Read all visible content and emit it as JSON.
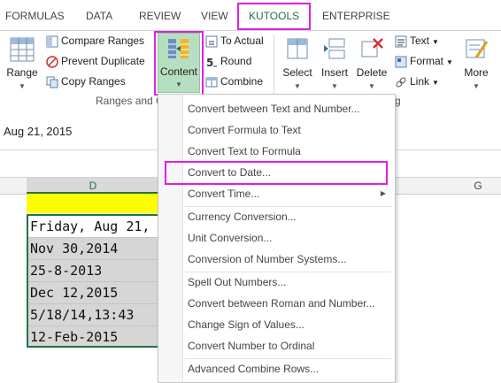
{
  "tabs": [
    {
      "label": "FORMULAS"
    },
    {
      "label": "DATA"
    },
    {
      "label": "REVIEW"
    },
    {
      "label": "VIEW"
    },
    {
      "label": "KUTOOLS"
    },
    {
      "label": "ENTERPRISE"
    }
  ],
  "ribbon": {
    "range_label": "Range",
    "compare_ranges": "Compare Ranges",
    "prevent_duplicate": "Prevent Duplicate",
    "copy_ranges": "Copy Ranges",
    "content_label": "Content",
    "to_actual": "To Actual",
    "round": "Round",
    "combine": "Combine",
    "select": "Select",
    "insert": "Insert",
    "delete": "Delete",
    "text": "Text",
    "format": "Format",
    "link": "Link",
    "more": "More",
    "group_label": "Ranges and C",
    "group2_tail": "g"
  },
  "formula_bar": {
    "value": "Aug 21, 2015"
  },
  "sheet": {
    "col_d": "D",
    "col_g": "G",
    "cells": [
      "Friday, Aug 21,",
      "Nov 30,2014",
      "25-8-2013",
      "Dec 12,2015",
      "5/18/14,13:43",
      "12-Feb-2015"
    ]
  },
  "menu": {
    "items": [
      "Convert between Text and Number...",
      "Convert Formula to Text",
      "Convert Text to Formula",
      "Convert to Date...",
      "Convert Time...",
      "Currency Conversion...",
      "Unit Conversion...",
      "Conversion of Number Systems...",
      "Spell Out Numbers...",
      "Convert between Roman and Number...",
      "Change Sign of Values...",
      "Convert Number to Ordinal",
      "Advanced Combine Rows..."
    ]
  },
  "colors": {
    "accent": "#217346",
    "highlight": "#e020e0",
    "yellow": "#ffff00"
  }
}
